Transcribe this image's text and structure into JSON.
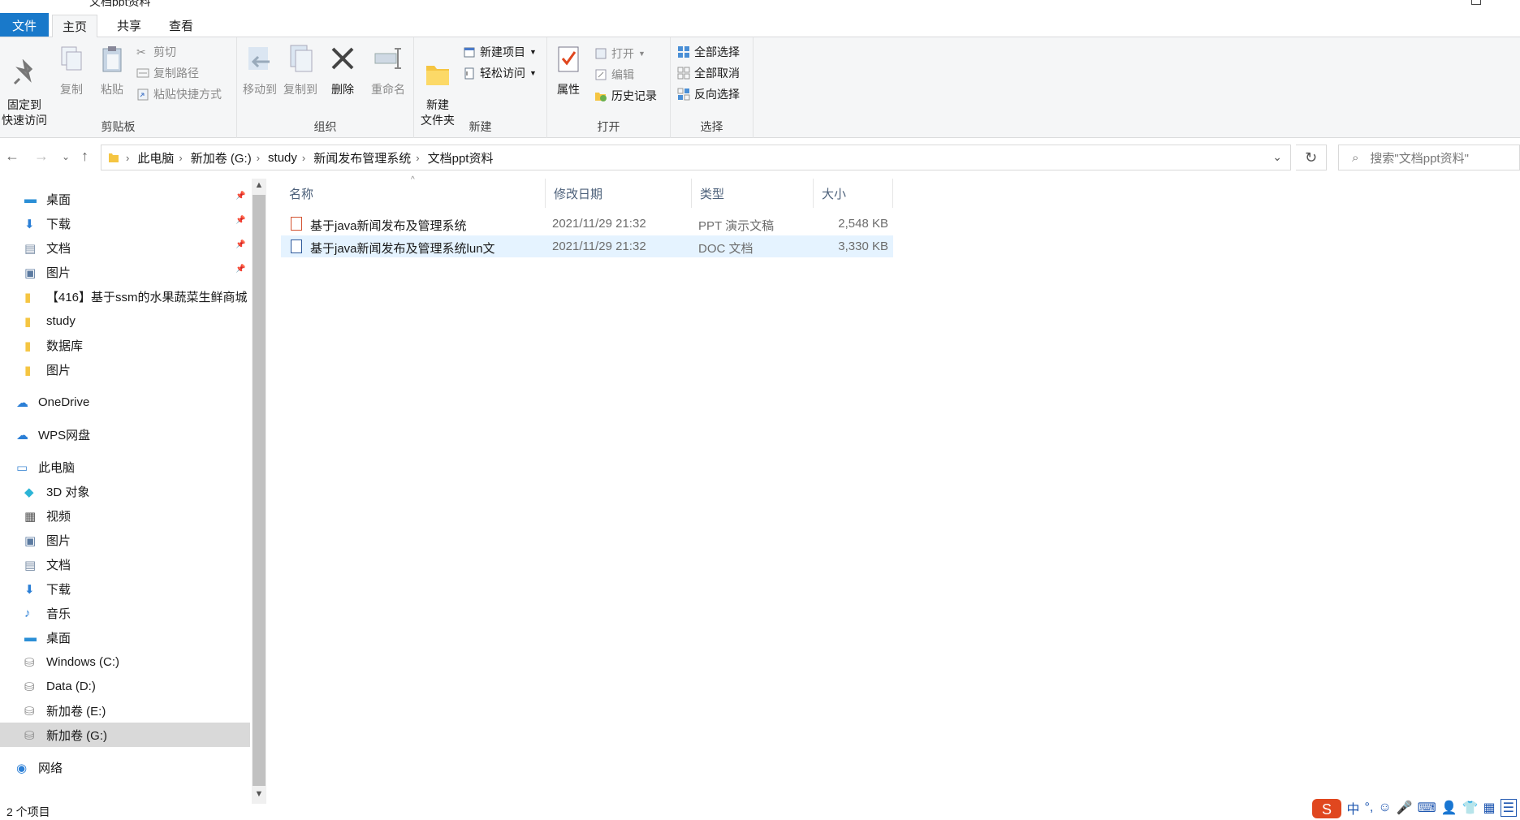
{
  "window": {
    "title": "文档ppt资料"
  },
  "tabs": {
    "file": "文件",
    "home": "主页",
    "share": "共享",
    "view": "查看"
  },
  "ribbon": {
    "clipboard": {
      "label": "剪贴板",
      "pin": "固定到\n快速访问",
      "copy": "复制",
      "paste": "粘贴",
      "cut": "剪切",
      "copy_path": "复制路径",
      "paste_shortcut": "粘贴快捷方式"
    },
    "organize": {
      "label": "组织",
      "move_to": "移动到",
      "copy_to": "复制到",
      "delete": "删除",
      "rename": "重命名"
    },
    "new": {
      "label": "新建",
      "new_folder": "新建\n文件夹",
      "new_item": "新建项目",
      "easy_access": "轻松访问"
    },
    "open": {
      "label": "打开",
      "properties": "属性",
      "open": "打开",
      "edit": "编辑",
      "history": "历史记录"
    },
    "select": {
      "label": "选择",
      "select_all": "全部选择",
      "select_none": "全部取消",
      "invert": "反向选择"
    }
  },
  "address": {
    "crumbs": [
      "此电脑",
      "新加卷 (G:)",
      "study",
      "新闻发布管理系统",
      "文档ppt资料"
    ],
    "search_placeholder": "搜索\"文档ppt资料\""
  },
  "nav": {
    "items": [
      {
        "label": "桌面",
        "icon": "desktop-icon",
        "pinned": true
      },
      {
        "label": "下载",
        "icon": "download-icon",
        "pinned": true
      },
      {
        "label": "文档",
        "icon": "document-icon",
        "pinned": true
      },
      {
        "label": "图片",
        "icon": "pictures-icon",
        "pinned": true
      },
      {
        "label": "【416】基于ssm的水果蔬菜生鲜商城",
        "icon": "folder-icon"
      },
      {
        "label": "study",
        "icon": "folder-icon"
      },
      {
        "label": "数据库",
        "icon": "folder-icon"
      },
      {
        "label": "图片",
        "icon": "folder-icon"
      },
      {
        "label": "OneDrive",
        "icon": "cloud-icon"
      },
      {
        "label": "WPS网盘",
        "icon": "cloud-icon"
      },
      {
        "label": "此电脑",
        "icon": "computer-icon"
      },
      {
        "label": "3D 对象",
        "icon": "cube-icon"
      },
      {
        "label": "视频",
        "icon": "video-icon"
      },
      {
        "label": "图片",
        "icon": "pictures-icon"
      },
      {
        "label": "文档",
        "icon": "document-icon"
      },
      {
        "label": "下载",
        "icon": "download-icon"
      },
      {
        "label": "音乐",
        "icon": "music-icon"
      },
      {
        "label": "桌面",
        "icon": "desktop-icon"
      },
      {
        "label": "Windows (C:)",
        "icon": "drive-icon"
      },
      {
        "label": "Data (D:)",
        "icon": "drive-icon"
      },
      {
        "label": "新加卷 (E:)",
        "icon": "drive-icon"
      },
      {
        "label": "新加卷 (G:)",
        "icon": "drive-icon",
        "selected": true
      },
      {
        "label": "网络",
        "icon": "network-icon"
      }
    ]
  },
  "columns": {
    "name": "名称",
    "modified": "修改日期",
    "type": "类型",
    "size": "大小"
  },
  "files": [
    {
      "name": "基于java新闻发布及管理系统",
      "modified": "2021/11/29 21:32",
      "type": "PPT 演示文稿",
      "size": "2,548 KB",
      "icon": "ppt-file-icon"
    },
    {
      "name": "基于java新闻发布及管理系统lun文",
      "modified": "2021/11/29 21:32",
      "type": "DOC 文档",
      "size": "3,330 KB",
      "icon": "doc-file-icon"
    }
  ],
  "status": {
    "count": "2 个项目"
  },
  "tray": {
    "ime": "中"
  },
  "colors": {
    "accent": "#1979ca",
    "hover": "#e5f3ff",
    "selected_nav": "#d9d9d9"
  }
}
